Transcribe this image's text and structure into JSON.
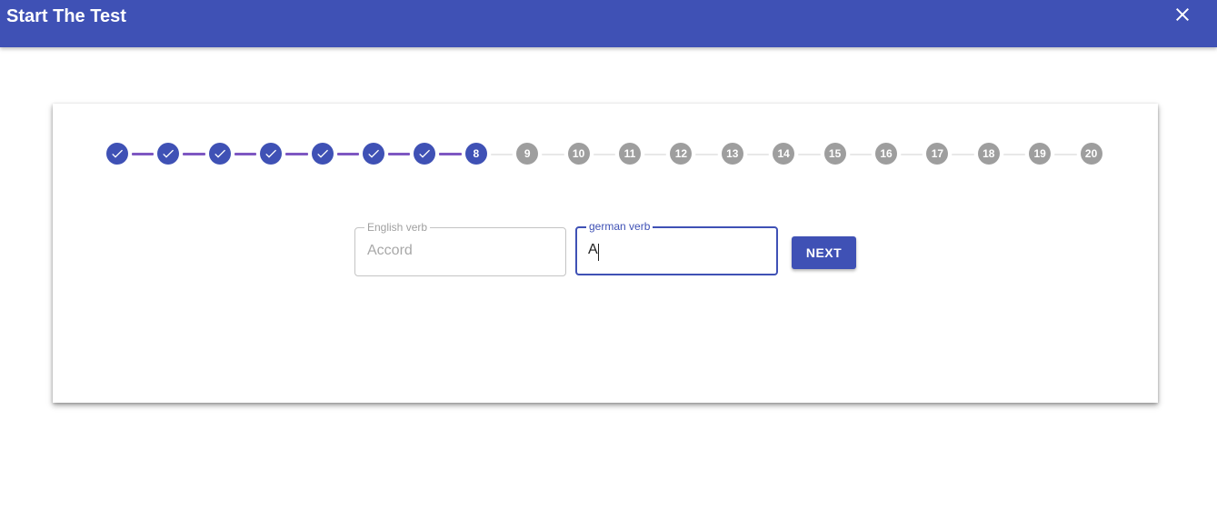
{
  "header": {
    "title": "Start The Test",
    "close_icon": "close-icon",
    "background": "#3f51b5"
  },
  "stepper": {
    "current_step": 8,
    "total_steps": 20,
    "steps": [
      {
        "label": "",
        "state": "done",
        "icon": "check-icon"
      },
      {
        "label": "",
        "state": "done",
        "icon": "check-icon"
      },
      {
        "label": "",
        "state": "done",
        "icon": "check-icon"
      },
      {
        "label": "",
        "state": "done",
        "icon": "check-icon"
      },
      {
        "label": "",
        "state": "done",
        "icon": "check-icon"
      },
      {
        "label": "",
        "state": "done",
        "icon": "check-icon"
      },
      {
        "label": "",
        "state": "done",
        "icon": "check-icon"
      },
      {
        "label": "8",
        "state": "active"
      },
      {
        "label": "9",
        "state": "pending"
      },
      {
        "label": "10",
        "state": "pending"
      },
      {
        "label": "11",
        "state": "pending"
      },
      {
        "label": "12",
        "state": "pending"
      },
      {
        "label": "13",
        "state": "pending"
      },
      {
        "label": "14",
        "state": "pending"
      },
      {
        "label": "15",
        "state": "pending"
      },
      {
        "label": "16",
        "state": "pending"
      },
      {
        "label": "17",
        "state": "pending"
      },
      {
        "label": "18",
        "state": "pending"
      },
      {
        "label": "19",
        "state": "pending"
      },
      {
        "label": "20",
        "state": "pending"
      }
    ],
    "colors": {
      "done": "#3f51b5",
      "pending": "#9e9e9e",
      "connector_done": "#7e57c2",
      "connector_pending": "#e8e8e8"
    }
  },
  "form": {
    "english_verb": {
      "label": "English verb",
      "value": "Accord"
    },
    "german_verb": {
      "label": "german verb",
      "value": "A"
    },
    "next_button": {
      "label": "NEXT"
    }
  }
}
